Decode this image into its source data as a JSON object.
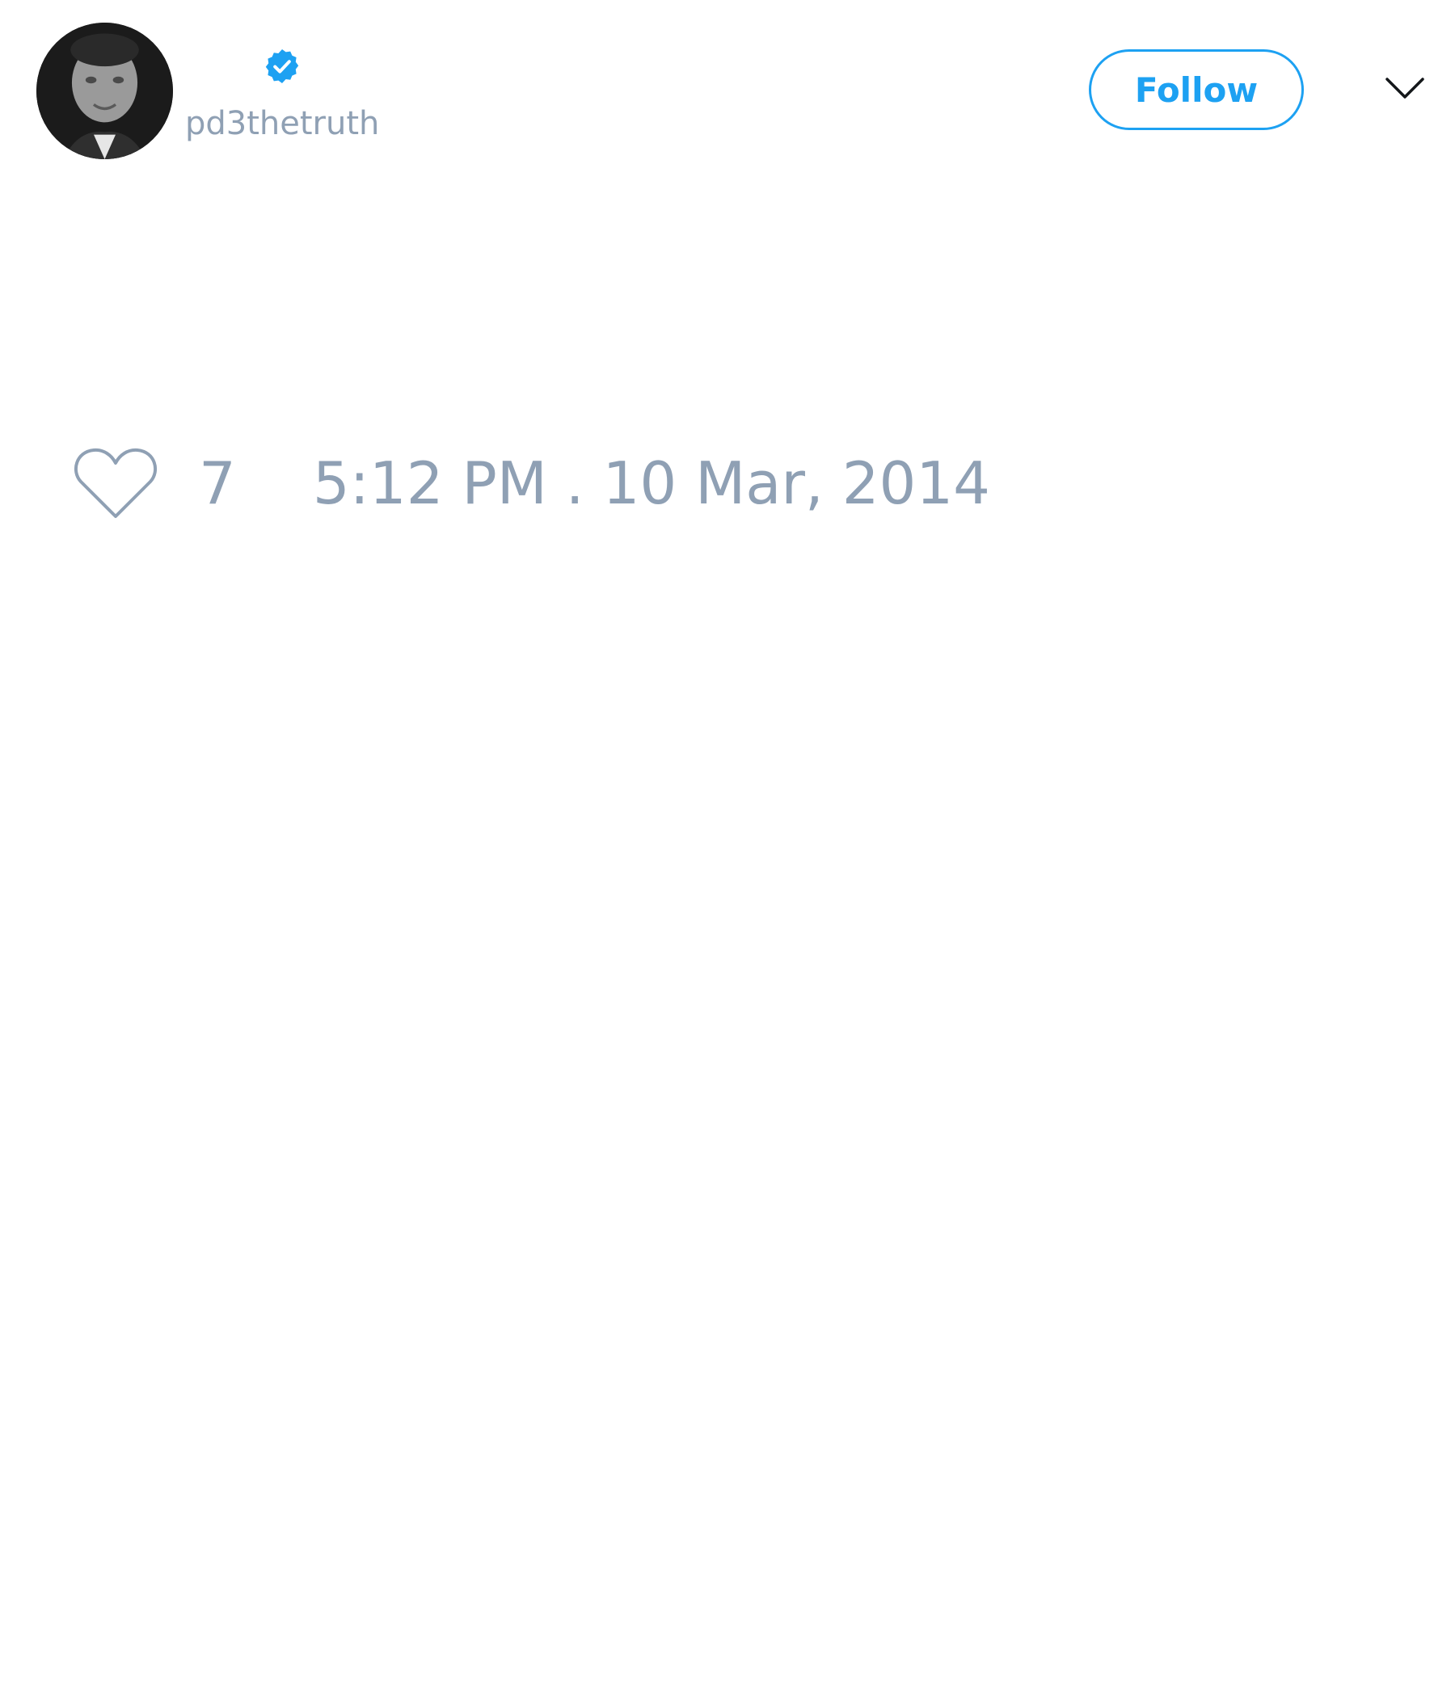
{
  "tweet": {
    "author": {
      "display_name": "",
      "username": "pd3thetruth",
      "verified": true,
      "avatar_icon": "profile-photo"
    },
    "follow_label": "Follow",
    "menu_icon": "chevron-down-icon",
    "like_icon": "heart-outline-icon",
    "like_count": "7",
    "timestamp": "5:12 PM . 10 Mar, 2014"
  },
  "colors": {
    "accent": "#1da1f2",
    "muted_text": "#8fa0b4",
    "background": "#ffffff"
  }
}
